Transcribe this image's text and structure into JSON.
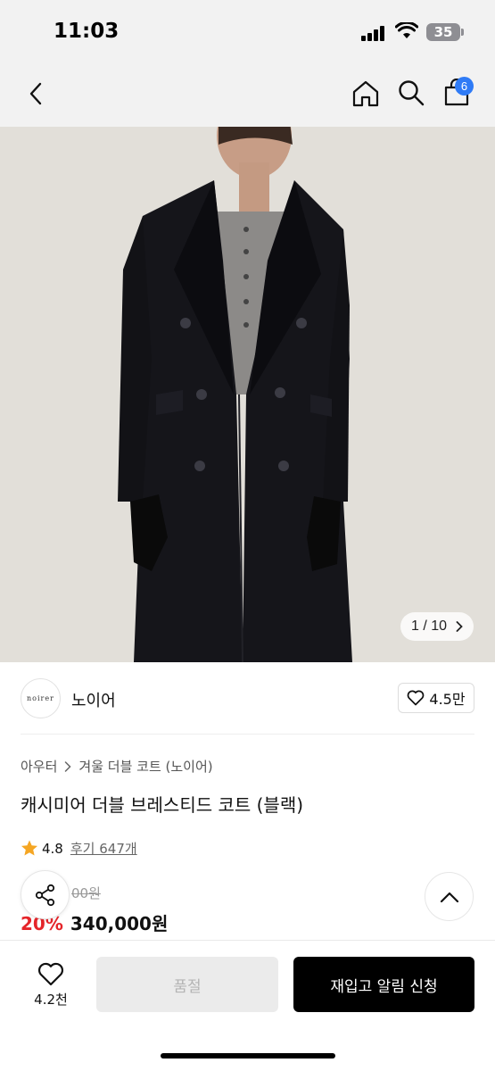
{
  "status_bar": {
    "time": "11:03",
    "battery": "35",
    "icons": [
      "signal-icon",
      "wifi-icon",
      "battery-icon"
    ]
  },
  "nav": {
    "icons": [
      "back-chevron-icon",
      "home-icon",
      "search-icon",
      "cart-icon"
    ],
    "cart_count": "6"
  },
  "gallery": {
    "current": "1",
    "separator": "/",
    "total": "10",
    "counter_text": "1 / 10",
    "image_subject": "black cashmere double-breasted long coat worn by model with black gloves"
  },
  "brand": {
    "logo_text": "noirer",
    "name": "노이어",
    "likes": "4.5만"
  },
  "product": {
    "breadcrumb": [
      "아우터",
      "겨울 더블 코트 (노이어)"
    ],
    "title": "캐시미어 더블 브레스티드 코트 (블랙)",
    "rating": "4.8",
    "review_text": "후기 647개",
    "original_price": "00원",
    "discount": "20%",
    "price": "340,000원"
  },
  "bottom_bar": {
    "wish_count": "4.2천",
    "soldout_label": "품절",
    "restock_label": "재입고 알림 신청"
  },
  "colors": {
    "accent_blue": "#2f7bf6",
    "discount_red": "#e5252a",
    "star_yellow": "#f5a623",
    "primary_black": "#000000",
    "disabled_gray": "#ebebeb"
  }
}
